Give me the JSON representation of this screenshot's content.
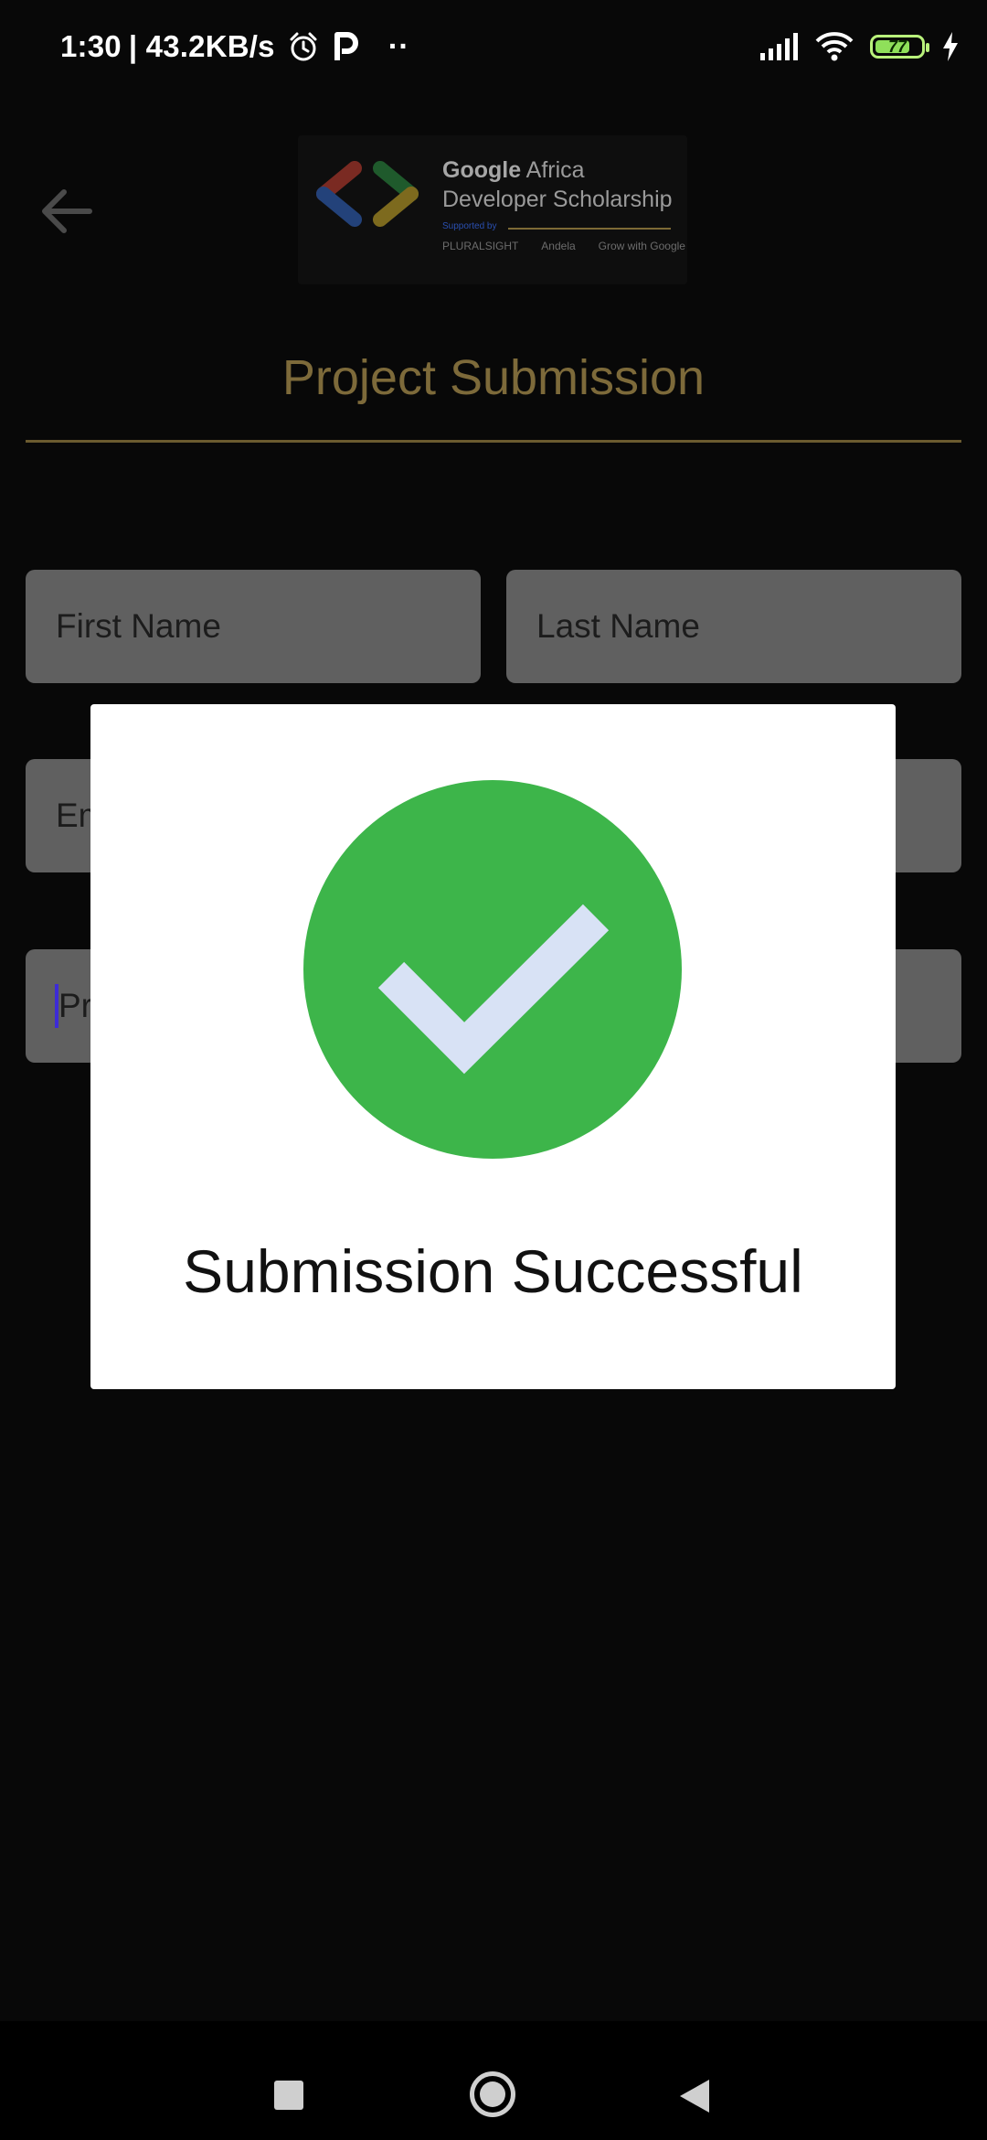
{
  "status_bar": {
    "time": "1:30",
    "net_speed": "| 43.2KB/s",
    "more_dots": "··",
    "battery_level": 77,
    "battery_text": "77",
    "icons": [
      "alarm-icon",
      "p-app-icon",
      "signal-icon",
      "wifi-icon",
      "battery-icon",
      "charging-icon"
    ]
  },
  "header": {
    "back_icon": "arrow-left-icon",
    "logo": {
      "title_bold": "Google",
      "title_rest": " Africa",
      "title_line2": "Developer Scholarship",
      "supported_by": "Supported by",
      "partners": [
        "PLURALSIGHT",
        "Andela",
        "Grow with Google"
      ]
    },
    "title": "Project Submission"
  },
  "form": {
    "first_name_placeholder": "First Name",
    "last_name_placeholder": "Last Name",
    "email_placeholder_visible": "Em",
    "project_link_placeholder_visible": "Pr"
  },
  "dialog": {
    "message": "Submission Successful",
    "icon": "check-circle-icon",
    "colors": {
      "circle": "#3DB54A",
      "check": "#D8E2F5"
    }
  },
  "nav_bar": {
    "icons": [
      "recent-apps-icon",
      "home-icon",
      "back-icon"
    ]
  },
  "colors": {
    "accent_gold": "#7D6A3A",
    "field_bg": "#606060",
    "scrim_bg": "#080808"
  }
}
